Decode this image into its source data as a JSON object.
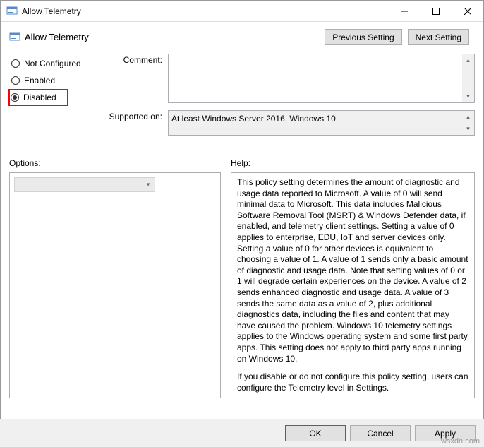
{
  "window": {
    "title": "Allow Telemetry"
  },
  "header": {
    "title": "Allow Telemetry",
    "prev": "Previous Setting",
    "next": "Next Setting"
  },
  "radios": {
    "not_configured": "Not Configured",
    "enabled": "Enabled",
    "disabled": "Disabled",
    "selected": "disabled"
  },
  "fields": {
    "comment_label": "Comment:",
    "comment_value": "",
    "supported_label": "Supported on:",
    "supported_value": "At least Windows Server 2016, Windows 10"
  },
  "lower": {
    "options_label": "Options:",
    "help_label": "Help:"
  },
  "help": {
    "p1": "This policy setting determines the amount of diagnostic and usage data reported to Microsoft. A value of 0 will send minimal data to Microsoft. This data includes Malicious Software Removal Tool (MSRT) & Windows Defender data, if enabled, and telemetry client settings. Setting a value of 0 applies to enterprise, EDU, IoT and server devices only. Setting a value of 0 for other devices is equivalent to choosing a value of 1. A value of 1 sends only a basic amount of diagnostic and usage data. Note that setting values of 0 or 1 will degrade certain experiences on the device. A value of 2 sends enhanced diagnostic and usage data. A value of 3 sends the same data as a value of 2, plus additional diagnostics data, including the files and content that may have caused the problem. Windows 10 telemetry settings applies to the Windows operating system and some first party apps. This setting does not apply to third party apps running on Windows 10.",
    "p2": "If you disable or do not configure this policy setting, users can configure the Telemetry level in Settings."
  },
  "footer": {
    "ok": "OK",
    "cancel": "Cancel",
    "apply": "Apply"
  },
  "watermark": "wsxdn.com"
}
